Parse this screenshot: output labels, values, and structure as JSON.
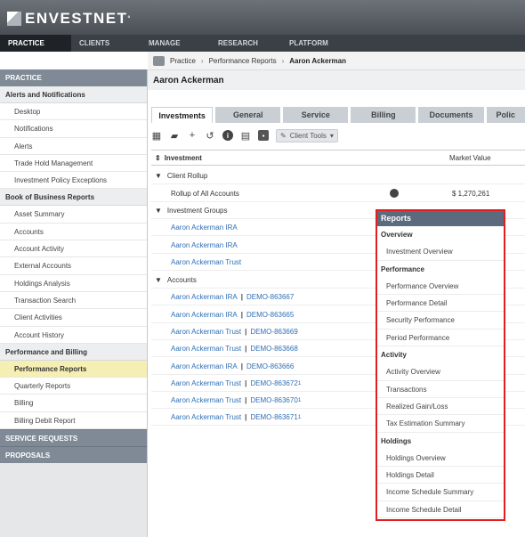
{
  "brand": {
    "name": "ENVESTNET",
    "tm": "°"
  },
  "nav": [
    "PRACTICE",
    "CLIENTS",
    "MANAGE",
    "RESEARCH",
    "PLATFORM"
  ],
  "breadcrumb": {
    "items": [
      "Practice",
      "Performance Reports"
    ],
    "current": "Aaron Ackerman"
  },
  "sidebar": {
    "title": "PRACTICE",
    "sections": [
      {
        "label": "Alerts and Notifications",
        "items": [
          "Desktop",
          "Notifications",
          "Alerts",
          "Trade Hold Management",
          "Investment Policy Exceptions"
        ]
      },
      {
        "label": "Book of Business Reports",
        "items": [
          "Asset Summary",
          "Accounts",
          "Account Activity",
          "External Accounts",
          "Holdings Analysis",
          "Transaction Search",
          "Client Activities",
          "Account History"
        ]
      },
      {
        "label": "Performance and Billing",
        "items": [
          "Performance Reports",
          "Quarterly Reports",
          "Billing",
          "Billing Debit Report"
        ]
      }
    ],
    "active_item": "Performance Reports",
    "bottom": [
      "SERVICE REQUESTS",
      "PROPOSALS"
    ]
  },
  "client_name": "Aaron Ackerman",
  "tabs": [
    "Investments",
    "General",
    "Service",
    "Billing",
    "Documents",
    "Polic"
  ],
  "toolbar": {
    "client_tools_label": "Client Tools"
  },
  "grid": {
    "col_investment": "Investment",
    "col_market_value": "Market Value",
    "client_rollup": "Client Rollup",
    "rollup_label": "Rollup of All Accounts",
    "rollup_value": "$ 1,270,261",
    "investment_groups": "Investment Groups",
    "groups": [
      "Aaron Ackerman IRA",
      "Aaron Ackerman IRA",
      "Aaron Ackerman Trust"
    ],
    "accounts_label": "Accounts",
    "accounts": [
      {
        "name": "Aaron Ackerman IRA",
        "id": "DEMO-863667",
        "sup": ""
      },
      {
        "name": "Aaron Ackerman IRA",
        "id": "DEMO-863665",
        "sup": ""
      },
      {
        "name": "Aaron Ackerman Trust",
        "id": "DEMO-863669",
        "sup": ""
      },
      {
        "name": "Aaron Ackerman Trust",
        "id": "DEMO-863668",
        "sup": ""
      },
      {
        "name": "Aaron Ackerman IRA",
        "id": "DEMO-863666",
        "sup": ""
      },
      {
        "name": "Aaron Ackerman Trust",
        "id": "DEMO-863672",
        "sup": "1"
      },
      {
        "name": "Aaron Ackerman Trust",
        "id": "DEMO-863670",
        "sup": "1"
      },
      {
        "name": "Aaron Ackerman Trust",
        "id": "DEMO-863671",
        "sup": "1"
      }
    ]
  },
  "reports": {
    "title": "Reports",
    "groups": [
      {
        "label": "Overview",
        "items": [
          "Investment Overview"
        ]
      },
      {
        "label": "Performance",
        "items": [
          "Performance Overview",
          "Performance Detail",
          "Security Performance",
          "Period Performance"
        ]
      },
      {
        "label": "Activity",
        "items": [
          "Activity Overview",
          "Transactions",
          "Realized Gain/Loss",
          "Tax Estimation Summary"
        ]
      },
      {
        "label": "Holdings",
        "items": [
          "Holdings Overview",
          "Holdings Detail",
          "Income Schedule Summary",
          "Income Schedule Detail"
        ]
      }
    ]
  }
}
